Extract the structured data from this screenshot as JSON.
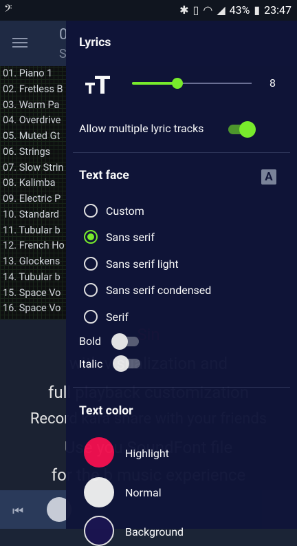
{
  "status": {
    "time": "23:47",
    "battery": "43%",
    "icons": [
      "music-app-icon",
      "bluetooth-icon",
      "vibrate-icon",
      "wifi-icon",
      "signal-icon",
      "battery-icon"
    ]
  },
  "background": {
    "title": "0",
    "subtitle": "S",
    "tracks": [
      "01. Piano 1",
      "02. Fretless B",
      "03. Warm Pa",
      "04. Overdrive",
      "05. Muted Gt",
      "06. Strings",
      "07. Slow Strin",
      "08. Kalimba",
      "09. Electric P",
      "10. Standard",
      "11. Tubular b",
      "12. French Ho",
      "13. Glockens",
      "14. Tubular b",
      "15. Space Vo",
      "16. Space Vo"
    ],
    "promo": [
      "Sin",
      "with v        sualization and",
      "full playback customization",
      "Record kara            share with your friends",
      "Use you          SoundFont file",
      "for the b      music experience"
    ]
  },
  "drawer": {
    "lyrics": {
      "title": "Lyrics",
      "text_size_value": "8",
      "text_size_fraction": 0.38,
      "allow_multiple_label": "Allow multiple lyric tracks",
      "allow_multiple_on": true
    },
    "text_face": {
      "title": "Text face",
      "options": [
        "Custom",
        "Sans serif",
        "Sans serif light",
        "Sans serif condensed",
        "Serif"
      ],
      "selected": "Sans serif",
      "bold_label": "Bold",
      "bold_on": false,
      "italic_label": "Italic",
      "italic_on": false
    },
    "text_color": {
      "title": "Text color",
      "colors": [
        {
          "label": "Highlight",
          "color": "#f0104f"
        },
        {
          "label": "Normal",
          "color": "#eeeeee"
        },
        {
          "label": "Background",
          "color": "#1a1450"
        }
      ]
    },
    "accent": "#7cf22c"
  }
}
